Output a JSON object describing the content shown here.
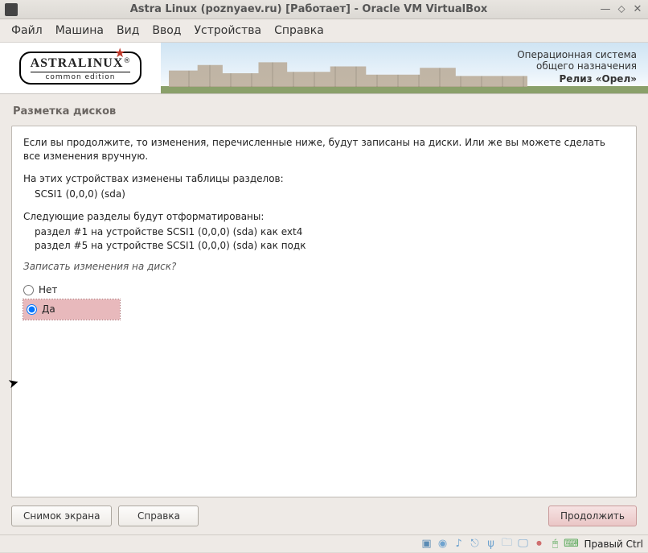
{
  "titlebar": {
    "title": "Astra Linux (poznyaev.ru) [Работает] - Oracle VM VirtualBox"
  },
  "menubar": {
    "items": [
      "Файл",
      "Машина",
      "Вид",
      "Ввод",
      "Устройства",
      "Справка"
    ]
  },
  "banner": {
    "logo_main": "ASTRALINUX",
    "logo_sub": "common edition",
    "info_line1": "Операционная система",
    "info_line2": "общего назначения",
    "info_release": "Релиз «Орел»"
  },
  "installer": {
    "section_title": "Разметка дисков",
    "para_intro": "Если вы продолжите, то изменения, перечисленные ниже, будут записаны на диски. Или же вы можете сделать все изменения вручную.",
    "para_devices_header": "На этих устройствах изменены таблицы разделов:",
    "device_line": "SCSI1 (0,0,0) (sda)",
    "para_partitions_header": "Следующие разделы будут отформатированы:",
    "partition_line1": "раздел #1 на устройстве SCSI1 (0,0,0) (sda) как ext4",
    "partition_line2": "раздел #5 на устройстве SCSI1 (0,0,0) (sda) как подк",
    "question": "Записать изменения на диск?",
    "option_no": "Нет",
    "option_yes": "Да",
    "selected": "yes"
  },
  "buttons": {
    "screenshot": "Снимок экрана",
    "help": "Справка",
    "continue": "Продолжить"
  },
  "statusbar": {
    "hostkey": "Правый Ctrl"
  }
}
